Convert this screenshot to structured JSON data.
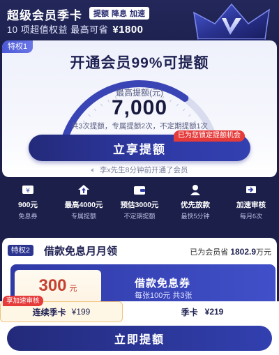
{
  "header": {
    "title": "超级会员季卡",
    "tags": [
      "提额",
      "降息",
      "加速"
    ],
    "subtitle_prefix": "10 项超值权益  最高可省",
    "subtitle_amount": "¥1800"
  },
  "privilege1": {
    "badge": "特权1",
    "title": "开通会员99%可提额",
    "max_label": "最高提额(元)",
    "max_amount": "7,000",
    "count_line": "共3次提额，专属提额2次，不定期提额1次",
    "cta": "立享提额",
    "lock_tag": "已为您锁定提额机会",
    "notice": "李x先生8分钟前开通了会员",
    "gauge_fill": 0.72
  },
  "privileges": [
    {
      "main": "900元",
      "sub": "免息券",
      "icon": "coupon-icon"
    },
    {
      "main": "最高4000元",
      "sub": "专属提额",
      "icon": "house-arrow-icon"
    },
    {
      "main": "预估3000元",
      "sub": "不定期提额",
      "icon": "wallet-icon"
    },
    {
      "main": "优先放款",
      "sub": "最快5分钟",
      "icon": "user-icon"
    },
    {
      "main": "加速审核",
      "sub": "每月6次",
      "icon": "speed-icon"
    }
  ],
  "privilege2": {
    "badge": "特权2",
    "title": "借款免息月月领",
    "save_prefix": "已为会员省",
    "save_amount": "1802.9",
    "save_suffix": "万元",
    "coupon_amount": "300",
    "coupon_unit": "元",
    "coupon_title": "借款免息券",
    "coupon_sub": "每张100元 共3张"
  },
  "plans": {
    "accel_tag": "享加速审核",
    "plan_a_name": "连续季卡",
    "plan_a_price": "¥199",
    "plan_b_name": "季卡",
    "plan_b_price": "¥219"
  },
  "bottom": {
    "cta": "立即提额"
  },
  "colors": {
    "brand": "#2f3aa6",
    "accent_red": "#e63b3b",
    "dark_bg": "#1c1f4a"
  }
}
